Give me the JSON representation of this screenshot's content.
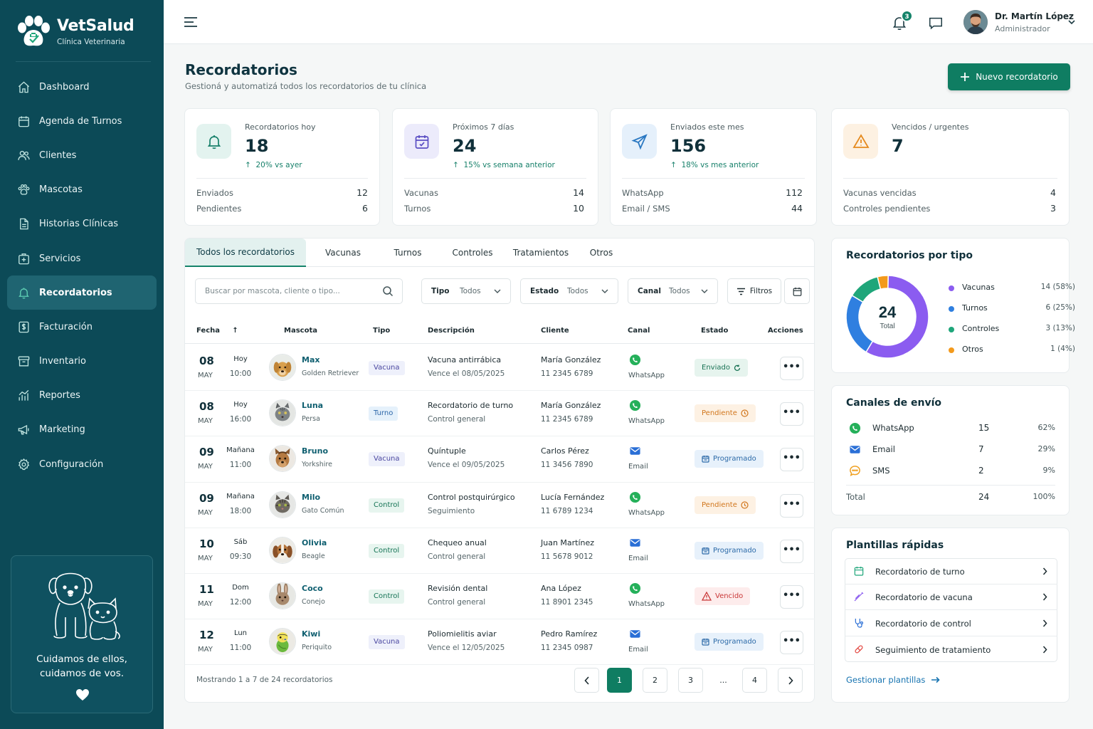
{
  "brand": {
    "name": "VetSalud",
    "subtitle": "Clínica Veterinaria"
  },
  "nav": [
    {
      "label": "Dashboard",
      "icon": "home-icon"
    },
    {
      "label": "Agenda de Turnos",
      "icon": "calendar-icon"
    },
    {
      "label": "Clientes",
      "icon": "users-icon"
    },
    {
      "label": "Mascotas",
      "icon": "paw-icon"
    },
    {
      "label": "Historias Clínicas",
      "icon": "file-icon"
    },
    {
      "label": "Servicios",
      "icon": "medical-kit-icon"
    },
    {
      "label": "Recordatorios",
      "icon": "bell-icon",
      "active": true
    },
    {
      "label": "Facturación",
      "icon": "invoice-icon"
    },
    {
      "label": "Inventario",
      "icon": "box-icon"
    },
    {
      "label": "Reportes",
      "icon": "chart-icon"
    },
    {
      "label": "Marketing",
      "icon": "megaphone-icon"
    },
    {
      "label": "Configuración",
      "icon": "gear-icon"
    }
  ],
  "promo": {
    "line1": "Cuidamos de ellos,",
    "line2": "cuidamos de vos."
  },
  "header": {
    "notifications": "3",
    "user_name": "Dr. Martín López",
    "user_role": "Administrador"
  },
  "page": {
    "title": "Recordatorios",
    "subtitle": "Gestioná y automatizá todos los recordatorios de tu clínica",
    "new_button": "Nuevo recordatorio"
  },
  "stats": [
    {
      "label": "Recordatorios hoy",
      "value": "18",
      "trend": "20% vs ayer",
      "rows": [
        [
          "Enviados",
          "12"
        ],
        [
          "Pendientes",
          "6"
        ]
      ],
      "icon": "bell-icon",
      "color": "#17806a"
    },
    {
      "label": "Próximos 7 días",
      "value": "24",
      "trend": "15% vs semana anterior",
      "rows": [
        [
          "Vacunas",
          "14"
        ],
        [
          "Turnos",
          "10"
        ]
      ],
      "icon": "calendar-icon",
      "color": "#5b4fc4"
    },
    {
      "label": "Enviados este mes",
      "value": "156",
      "trend": "18% vs mes anterior",
      "rows": [
        [
          "WhatsApp",
          "112"
        ],
        [
          "Email / SMS",
          "44"
        ]
      ],
      "icon": "send-icon",
      "color": "#2a78c2"
    },
    {
      "label": "Vencidos / urgentes",
      "value": "7",
      "trend": "",
      "rows": [
        [
          "Vacunas vencidas",
          "4"
        ],
        [
          "Controles pendientes",
          "3"
        ]
      ],
      "icon": "warning-icon",
      "color": "#e58a1f"
    }
  ],
  "tabs": [
    "Todos los recordatorios",
    "Vacunas",
    "Turnos",
    "Controles",
    "Tratamientos",
    "Otros"
  ],
  "filters": {
    "search_placeholder": "Buscar por mascota, cliente o tipo...",
    "tipo_label": "Tipo",
    "tipo_value": "Todos",
    "estado_label": "Estado",
    "estado_value": "Todos",
    "canal_label": "Canal",
    "canal_value": "Todos",
    "filters_button": "Filtros"
  },
  "table": {
    "headers": {
      "fecha": "Fecha",
      "mascota": "Mascota",
      "tipo": "Tipo",
      "descripcion": "Descripción",
      "cliente": "Cliente",
      "canal": "Canal",
      "estado": "Estado",
      "acciones": "Acciones"
    },
    "rows": [
      {
        "day": "08",
        "month": "MAY",
        "rel": "Hoy",
        "time": "10:00",
        "pet": "Max",
        "breed": "Golden Retriever",
        "species": "dog-golden",
        "type": "Vacuna",
        "type_class": "vacuna",
        "desc": "Vacuna antirrábica",
        "desc2": "Vence el 08/05/2025",
        "client": "María González",
        "phone": "11 2345 6789",
        "channel": "WhatsApp",
        "status": "Enviado",
        "status_class": "enviado",
        "more": "•••"
      },
      {
        "day": "08",
        "month": "MAY",
        "rel": "Hoy",
        "time": "16:00",
        "pet": "Luna",
        "breed": "Persa",
        "species": "cat-gray",
        "type": "Turno",
        "type_class": "turno",
        "desc": "Recordatorio de turno",
        "desc2": "Control general",
        "client": "María González",
        "phone": "11 2345 6789",
        "channel": "WhatsApp",
        "status": "Pendiente",
        "status_class": "pendiente",
        "more": "•••"
      },
      {
        "day": "09",
        "month": "MAY",
        "rel": "Mañana",
        "time": "11:00",
        "pet": "Bruno",
        "breed": "Yorkshire",
        "species": "dog-yorkie",
        "type": "Vacuna",
        "type_class": "vacuna",
        "desc": "Quíntuple",
        "desc2": "Vence el 09/05/2025",
        "client": "Carlos Pérez",
        "phone": "11 3456 7890",
        "channel": "Email",
        "status": "Programado",
        "status_class": "programado",
        "more": "•••"
      },
      {
        "day": "09",
        "month": "MAY",
        "rel": "Mañana",
        "time": "18:00",
        "pet": "Milo",
        "breed": "Gato Común",
        "species": "cat-tabby",
        "type": "Control",
        "type_class": "control",
        "desc": "Control postquirúrgico",
        "desc2": "Seguimiento",
        "client": "Lucía Fernández",
        "phone": "11 6789 1234",
        "channel": "WhatsApp",
        "status": "Pendiente",
        "status_class": "pendiente",
        "more": "•••"
      },
      {
        "day": "10",
        "month": "MAY",
        "rel": "Sáb",
        "time": "09:30",
        "pet": "Olivia",
        "breed": "Beagle",
        "species": "dog-beagle",
        "type": "Control",
        "type_class": "control",
        "desc": "Chequeo anual",
        "desc2": "Control general",
        "client": "Juan Martínez",
        "phone": "11 5678 9012",
        "channel": "Email",
        "status": "Programado",
        "status_class": "programado",
        "more": "•••"
      },
      {
        "day": "11",
        "month": "MAY",
        "rel": "Dom",
        "time": "12:00",
        "pet": "Coco",
        "breed": "Conejo",
        "species": "rabbit",
        "type": "Control",
        "type_class": "control",
        "desc": "Revisión dental",
        "desc2": "Control general",
        "client": "Ana López",
        "phone": "11 8901 2345",
        "channel": "WhatsApp",
        "status": "Vencido",
        "status_class": "vencido",
        "more": "•••"
      },
      {
        "day": "12",
        "month": "MAY",
        "rel": "Lun",
        "time": "11:00",
        "pet": "Kiwi",
        "breed": "Periquito",
        "species": "parakeet",
        "type": "Vacuna",
        "type_class": "vacuna",
        "desc": "Poliomielitis aviar",
        "desc2": "Vence el 12/05/2025",
        "client": "Pedro Ramírez",
        "phone": "11 2345 0987",
        "channel": "Email",
        "status": "Programado",
        "status_class": "programado",
        "more": "•••"
      }
    ],
    "footer": "Mostrando 1 a 7 de 24 recordatorios",
    "pages": [
      "1",
      "2",
      "3",
      "...",
      "4"
    ]
  },
  "chart_data": {
    "type": "pie",
    "title": "Recordatorios por tipo",
    "center_value": "24",
    "center_label": "Total",
    "categories": [
      "Vacunas",
      "Turnos",
      "Controles",
      "Otros"
    ],
    "values": [
      14,
      6,
      3,
      1
    ],
    "value_labels": [
      "14 (58%)",
      "6 (25%)",
      "3 (13%)",
      "1 (4%)"
    ],
    "colors": [
      "#8b5cf0",
      "#2f7fe0",
      "#1fa67a",
      "#f39a1c"
    ]
  },
  "channels": {
    "title": "Canales de envío",
    "rows": [
      {
        "name": "WhatsApp",
        "count": "15",
        "pct": "62%"
      },
      {
        "name": "Email",
        "count": "7",
        "pct": "29%"
      },
      {
        "name": "SMS",
        "count": "2",
        "pct": "9%"
      }
    ],
    "total_label": "Total",
    "total_count": "24",
    "total_pct": "100%"
  },
  "templates": {
    "title": "Plantillas rápidas",
    "items": [
      "Recordatorio de turno",
      "Recordatorio de vacuna",
      "Recordatorio de control",
      "Seguimiento de tratamiento"
    ],
    "manage": "Gestionar plantillas"
  }
}
